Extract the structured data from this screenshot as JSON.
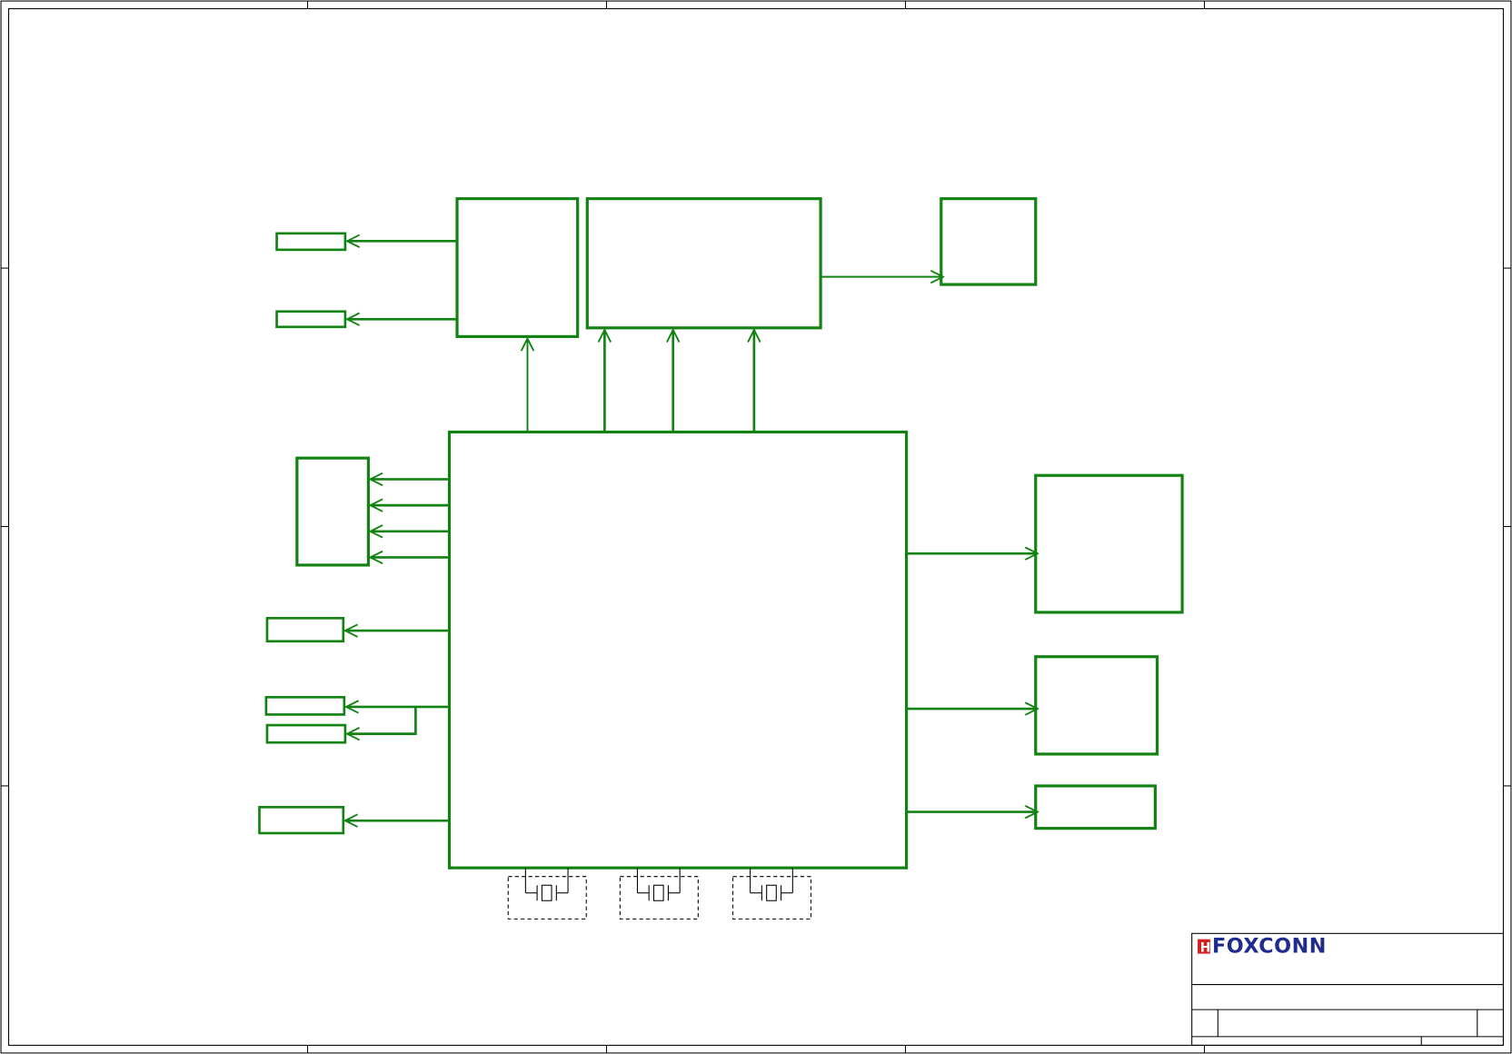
{
  "diagram": {
    "type": "schematic block diagram",
    "line_color": "#128212",
    "frame_color": "#000000",
    "crystal_count": 3
  },
  "title_block": {
    "company_logo": "FOXCONN",
    "logo_mark": "H",
    "registered_mark": "®",
    "logo_colors": {
      "text": "#1f2b8f",
      "mark": "#d42020"
    }
  }
}
